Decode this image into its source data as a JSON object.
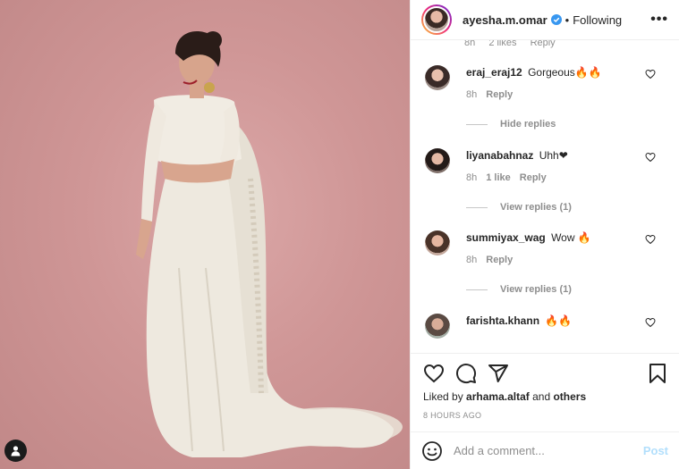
{
  "header": {
    "username": "ayesha.m.omar",
    "separator": "•",
    "follow_status": "Following",
    "more": "•••"
  },
  "partial_comment": {
    "time": "8h",
    "likes": "2 likes",
    "reply": "Reply"
  },
  "comments": [
    {
      "user": "eraj_eraj12",
      "text": "Gorgeous🔥🔥",
      "time": "8h",
      "likes": "",
      "reply": "Reply"
    },
    {
      "user": "liyanabahnaz",
      "text": "Uhh❤",
      "time": "8h",
      "likes": "1 like",
      "reply": "Reply"
    },
    {
      "user": "summiyax_wag",
      "text": "Wow 🔥",
      "time": "8h",
      "likes": "",
      "reply": "Reply"
    },
    {
      "user": "farishta.khann",
      "text": "🔥🔥",
      "time": "",
      "likes": "",
      "reply": ""
    }
  ],
  "reply_toggles": [
    "Hide replies",
    "View replies (1)",
    "View replies (1)"
  ],
  "likes": {
    "prefix": "Liked by",
    "user": "arhama.altaf",
    "conjunction": "and",
    "others": "others"
  },
  "timestamp": "8 HOURS AGO",
  "add_comment": {
    "placeholder": "Add a comment...",
    "post_label": "Post"
  },
  "colors": {
    "background_wall": "#cf9696",
    "verified_blue": "#3897f0",
    "post_button_disabled": "#b2dffc"
  },
  "icons": {
    "like": "heart-icon",
    "comment": "comment-bubble-icon",
    "share": "paper-plane-icon",
    "save": "bookmark-icon",
    "emoji": "smiley-icon",
    "tags": "user-tag-icon"
  }
}
